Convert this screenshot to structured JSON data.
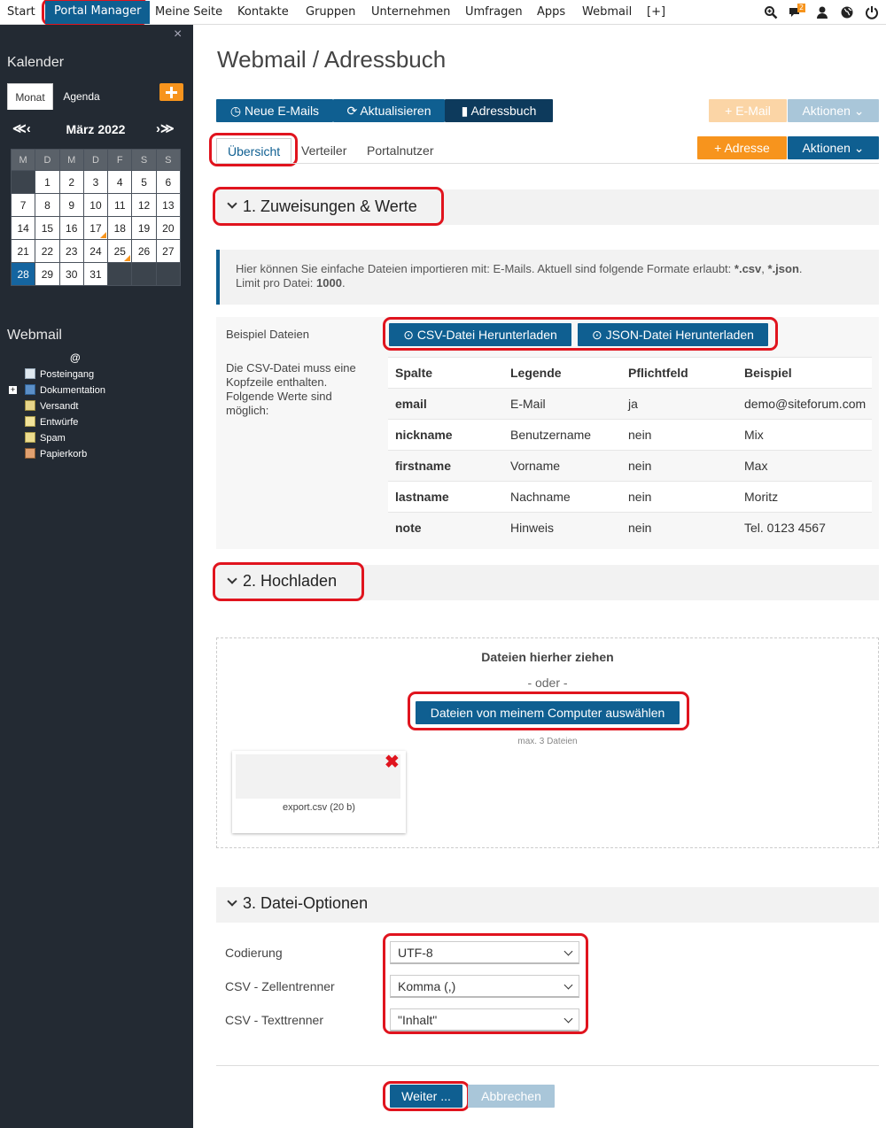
{
  "topnav": {
    "items": [
      "Start",
      "Portal Manager",
      "Meine Seite",
      "Kontakte",
      "Gruppen",
      "Unternehmen",
      "Umfragen",
      "Apps",
      "Webmail",
      "[+]"
    ],
    "badge": "2",
    "icons": [
      "search-zoom-icon",
      "chat-icon",
      "user-icon",
      "globe-icon",
      "power-icon"
    ]
  },
  "sidebar": {
    "close": "×",
    "calendar_title": "Kalender",
    "tabs": [
      "Monat",
      "Agenda"
    ],
    "month": "März 2022",
    "prev": "≪‹",
    "next": "›≫",
    "weekdays": [
      "M",
      "D",
      "M",
      "D",
      "F",
      "S",
      "S"
    ],
    "weeks": [
      [
        "",
        "1",
        "2",
        "3",
        "4",
        "5",
        "6"
      ],
      [
        "7",
        "8",
        "9",
        "10",
        "11",
        "12",
        "13"
      ],
      [
        "14",
        "15",
        "16",
        "17",
        "18",
        "19",
        "20"
      ],
      [
        "21",
        "22",
        "23",
        "24",
        "25",
        "26",
        "27"
      ],
      [
        "28",
        "29",
        "30",
        "31",
        "",
        "",
        ""
      ]
    ],
    "today": "28",
    "marked": [
      "17",
      "25"
    ],
    "webmail_title": "Webmail",
    "at": "@",
    "folders": [
      "Posteingang",
      "Dokumentation",
      "Versandt",
      "Entwürfe",
      "Spam",
      "Papierkorb"
    ]
  },
  "main": {
    "title": "Webmail / Adressbuch",
    "toolbar": {
      "new_mails": "Neue E-Mails",
      "refresh": "Aktualisieren",
      "addressbook": "Adressbuch",
      "email": "E-Mail",
      "actions": "Aktionen"
    },
    "tabs": [
      "Übersicht",
      "Verteiler",
      "Portalnutzer"
    ],
    "add_address": "Adresse",
    "actions2": "Aktionen",
    "section1": "1. Zuweisungen & Werte",
    "info": {
      "text": "Hier können Sie einfache Dateien importieren mit: E-Mails. Aktuell sind folgende Formate erlaubt: ",
      "fmt1": "*.csv",
      "sep": ", ",
      "fmt2": "*.json",
      "end": ".",
      "limit_label": "Limit pro Datei: ",
      "limit": "1000",
      "limit_end": "."
    },
    "example_label": "Beispiel Dateien",
    "csv_desc": "Die CSV-Datei muss eine Kopfzeile enthalten. Folgende Werte sind möglich:",
    "btn_csv": "CSV-Datei Herunterladen",
    "btn_json": "JSON-Datei Herunterladen",
    "table": {
      "headers": [
        "Spalte",
        "Legende",
        "Pflichtfeld",
        "Beispiel"
      ],
      "rows": [
        [
          "email",
          "E-Mail",
          "ja",
          "demo@siteforum.com"
        ],
        [
          "nickname",
          "Benutzername",
          "nein",
          "Mix"
        ],
        [
          "firstname",
          "Vorname",
          "nein",
          "Max"
        ],
        [
          "lastname",
          "Nachname",
          "nein",
          "Moritz"
        ],
        [
          "note",
          "Hinweis",
          "nein",
          "Tel. 0123 4567"
        ]
      ]
    },
    "section2": "2. Hochladen",
    "upload": {
      "drop": "Dateien hierher ziehen",
      "or": "- oder -",
      "choose": "Dateien von meinem Computer auswählen",
      "max": "max. 3 Dateien",
      "file": "export.csv (20 b)"
    },
    "section3": "3. Datei-Optionen",
    "options": [
      {
        "label": "Codierung",
        "value": "UTF-8"
      },
      {
        "label": "CSV - Zellentrenner",
        "value": "Komma (,)"
      },
      {
        "label": "CSV - Texttrenner",
        "value": "\"Inhalt\""
      }
    ],
    "next": "Weiter ...",
    "cancel": "Abbrechen"
  },
  "colors": {
    "primary": "#0f5f91",
    "orange": "#f7941d",
    "sidebar": "#232a33",
    "highlight": "#e0141e"
  }
}
